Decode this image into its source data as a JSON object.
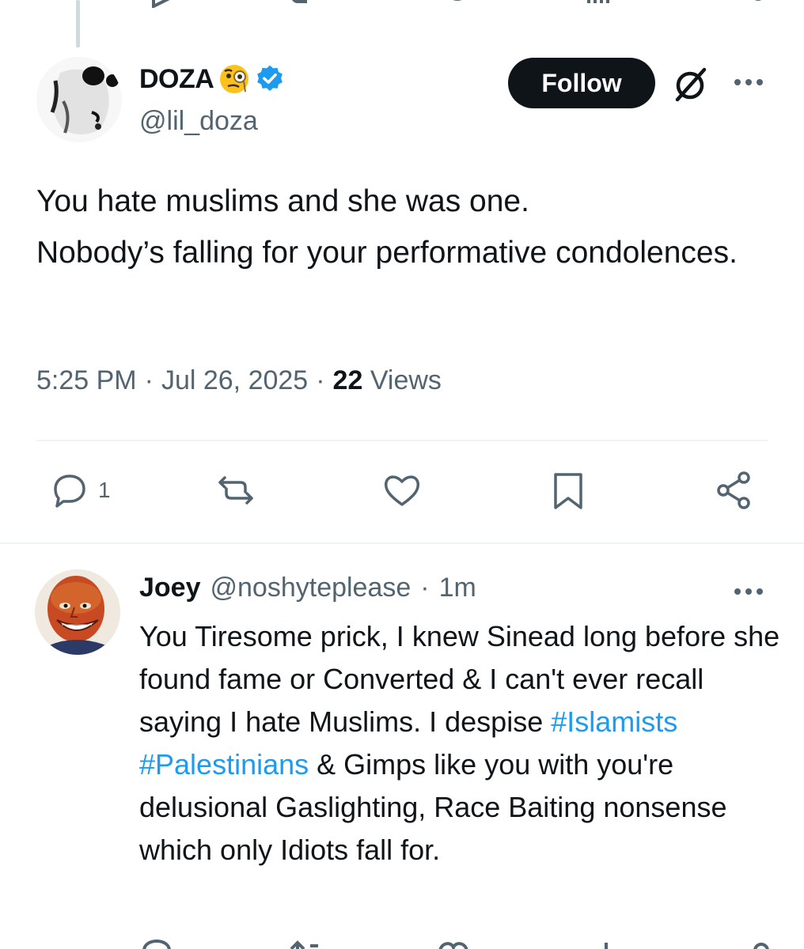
{
  "main_tweet": {
    "display_name": "DOZA",
    "handle": "@lil_doza",
    "follow_label": "Follow",
    "text": "You hate muslims and she was one.\nNobody’s falling for your performative condolences.",
    "time": "5:25 PM",
    "separator": "·",
    "date": "Jul 26, 2025",
    "views_count": "22",
    "views_label": "Views",
    "actions": {
      "reply_count": "1"
    }
  },
  "reply_tweet": {
    "display_name": "Joey",
    "handle": "@noshyteplease",
    "separator": "·",
    "time_ago": "1m",
    "text_part1": "You Tiresome prick, I knew Sinead long before she found fame or Converted & I can't ever recall saying I hate Muslims. I despise ",
    "hashtag1": "#Islamists",
    "space": " ",
    "hashtag2": "#Palestinians",
    "text_part2": " & Gimps like you with you're delusional Gaslighting, Race Baiting nonsense which only Idiots fall for."
  },
  "colors": {
    "text_primary": "#0f1419",
    "text_secondary": "#536471",
    "link": "#1d9bf0",
    "verified": "#1d9bf0",
    "follow_bg": "#0f1419",
    "divider": "#eff3f4"
  },
  "icons": {
    "verified": "verified-badge-icon",
    "emoji": "face-with-monocle-emoji",
    "grok": "grok-icon",
    "more": "more-horizontal-icon",
    "reply": "reply-icon",
    "repost": "repost-icon",
    "like": "heart-icon",
    "bookmark": "bookmark-icon",
    "share": "share-icon"
  }
}
